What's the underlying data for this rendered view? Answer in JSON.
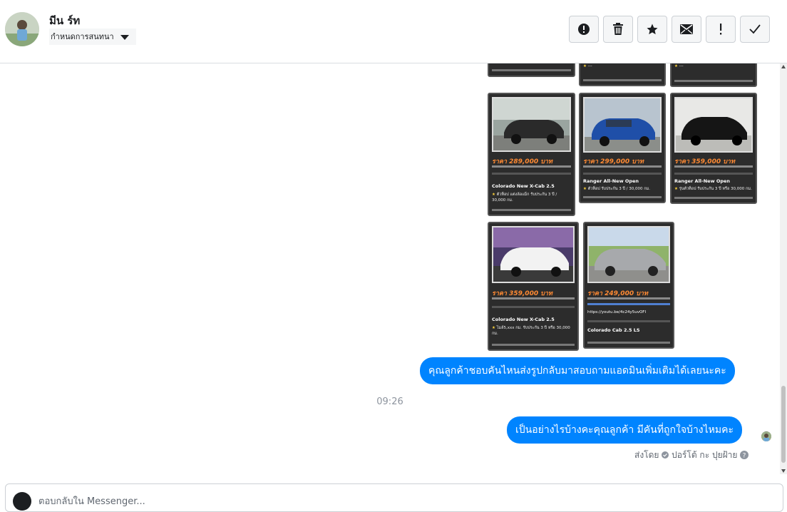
{
  "header": {
    "contact_name": "มีน ร์ท",
    "assign_label": "กำหนดการสนทนา",
    "toolbar": [
      {
        "name": "spam-button",
        "icon": "alert-circle-icon"
      },
      {
        "name": "delete-button",
        "icon": "trash-icon"
      },
      {
        "name": "star-button",
        "icon": "star-icon"
      },
      {
        "name": "mark-unread-button",
        "icon": "envelope-icon"
      },
      {
        "name": "follow-up-button",
        "icon": "exclamation-icon"
      },
      {
        "name": "done-button",
        "icon": "check-icon"
      }
    ]
  },
  "cars": [
    {
      "price": "ราคา 289,000 บาท",
      "model": "Colorado New X-Cab 2.5",
      "feature": "ตัวท็อป แต่งล้อแม็ก รับประกัน 3 ปี / 30,000 กม."
    },
    {
      "price": "ราคา 299,000 บาท",
      "model": "Ranger All-New Open",
      "feature": "ตัวท็อป รับประกัน 3 ปี / 30,000 กม."
    },
    {
      "price": "ราคา 359,000 บาท",
      "model": "Ranger All-New Open",
      "feature": "รุ่นตัวท็อป รับประกัน 3 ปี หรือ 30,000 กม."
    },
    {
      "price": "ราคา 359,000 บาท",
      "model": "Colorado New X-Cab 2.5",
      "feature": "ไมล์5,xxx กม. รับประกัน 3 ปี หรือ 30,000 กม."
    },
    {
      "price": "ราคา 249,000 บาท",
      "model": "Colorado Cab 2.5 LS",
      "feature": "https://youtu.be/4c24y5uvOFI"
    }
  ],
  "messages": [
    {
      "text": "คุณลูกค้าชอบคันไหนส่งรูปกลับมาสอบถามแอดมินเพิ่มเติมได้เลยนะคะ"
    },
    {
      "text": "เป็นอย่างไรบ้างคะคุณลูกค้า มีคันที่ถูกใจบ้างไหมคะ"
    }
  ],
  "timestamp": "09:26",
  "sent_by": "ส่งโดย",
  "sent_by_name": "ปอร์โต้ กะ ปุยฝ้าย",
  "composer": {
    "placeholder": "ตอบกลับใน Messenger..."
  },
  "colors": {
    "bubble": "#0084ff",
    "card_bg": "#2c2c2c",
    "price": "#ff8a33"
  }
}
